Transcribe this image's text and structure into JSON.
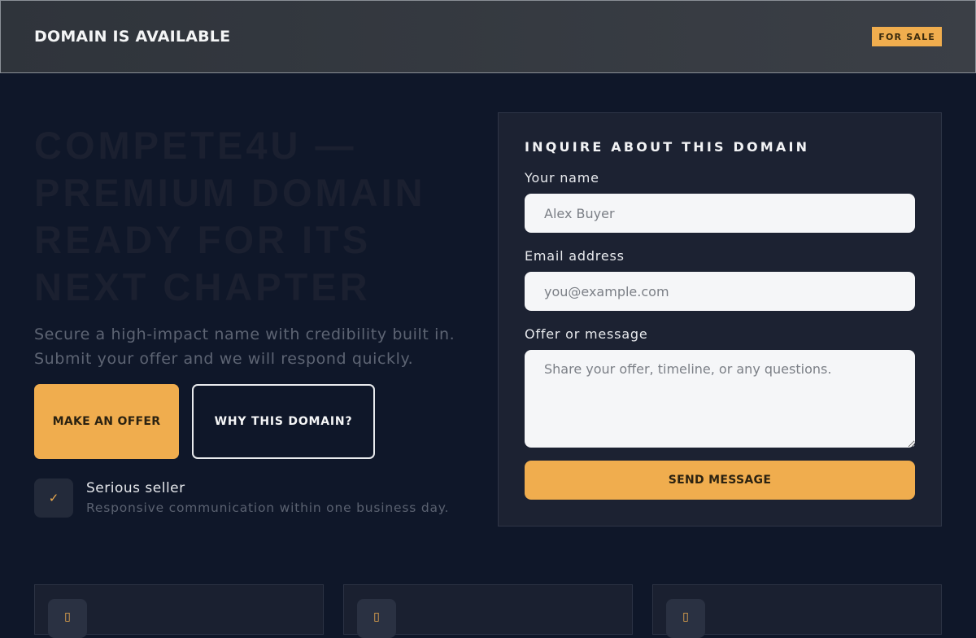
{
  "header": {
    "brand": "DOMAIN IS AVAILABLE",
    "badge": "FOR SALE"
  },
  "hero": {
    "title": "COMPETE4U — PREMIUM DOMAIN READY FOR ITS NEXT CHAPTER",
    "subtitle": "Secure a high-impact name with credibility built in. Submit your offer and we will respond quickly.",
    "offer_button": "MAKE AN OFFER",
    "why_button": "WHY THIS DOMAIN?",
    "seller": {
      "icon": "check-icon",
      "icon_glyph": "✓",
      "title": "Serious seller",
      "description": "Responsive communication within one business day."
    }
  },
  "form": {
    "title": "INQUIRE ABOUT THIS DOMAIN",
    "name_label": "Your name",
    "name_placeholder": "Alex Buyer",
    "email_label": "Email address",
    "email_placeholder": "you@example.com",
    "message_label": "Offer or message",
    "message_placeholder": "Share your offer, timeline, or any questions.",
    "send_button": "SEND MESSAGE"
  },
  "features": [
    {
      "icon": "feature-icon",
      "icon_glyph": "▯"
    },
    {
      "icon": "feature-icon",
      "icon_glyph": "▯"
    },
    {
      "icon": "feature-icon",
      "icon_glyph": "▯"
    }
  ],
  "colors": {
    "accent": "#f0ad4e",
    "background": "#0f1729",
    "card": "#1c2232"
  }
}
